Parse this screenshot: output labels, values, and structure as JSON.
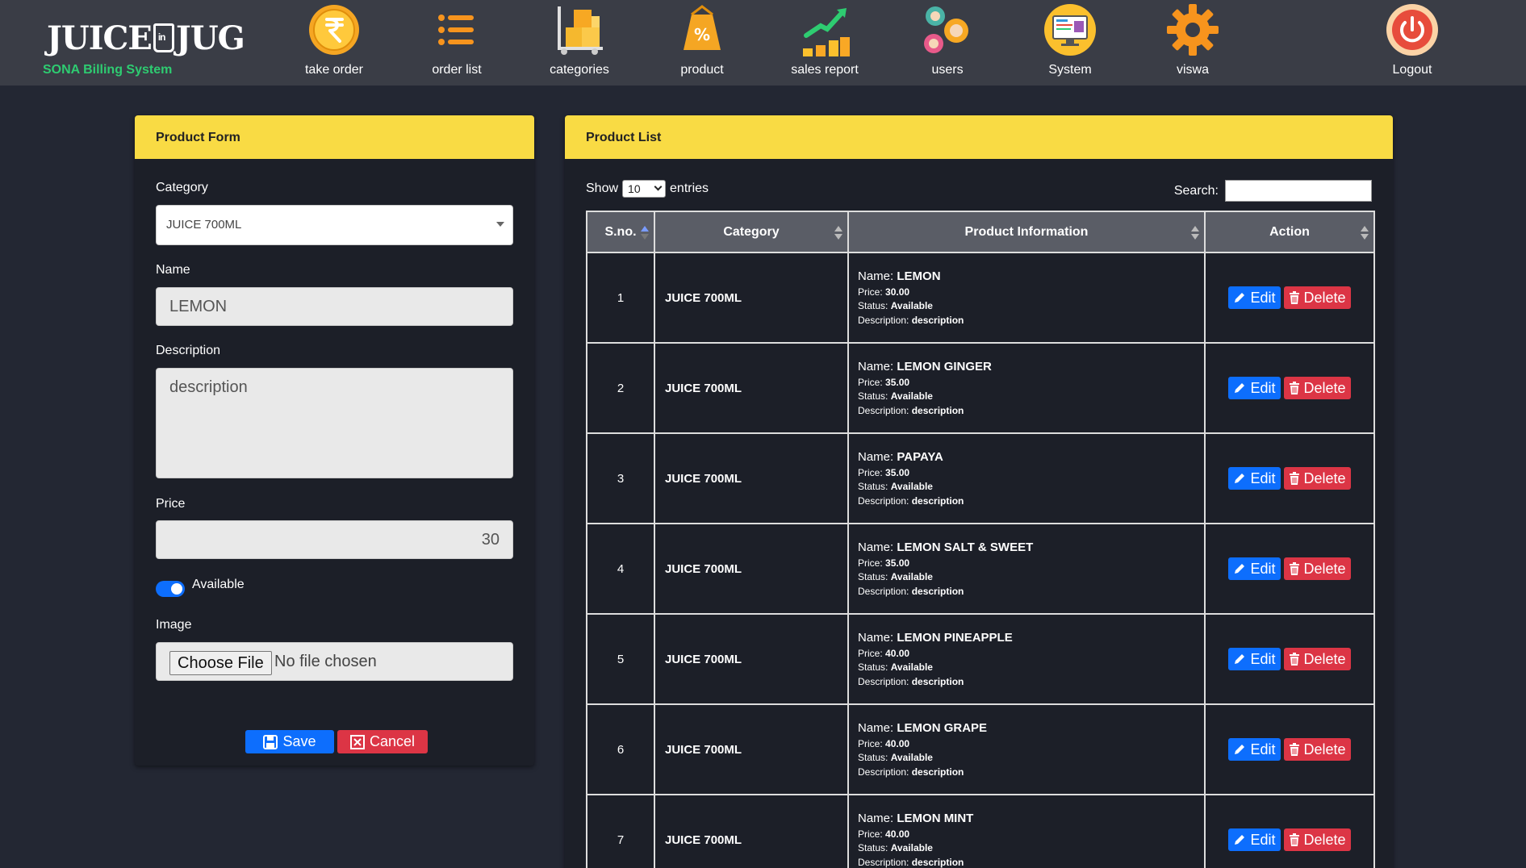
{
  "brand": {
    "logo": "JUICE IN JUG",
    "subtitle": "SONA Billing System"
  },
  "nav": [
    {
      "label": "take order",
      "icon": "rupee-coin-icon"
    },
    {
      "label": "order list",
      "icon": "list-icon"
    },
    {
      "label": "categories",
      "icon": "cart-boxes-icon"
    },
    {
      "label": "product",
      "icon": "price-tag-icon"
    },
    {
      "label": "sales report",
      "icon": "growth-chart-icon"
    },
    {
      "label": "users",
      "icon": "users-gears-icon"
    },
    {
      "label": "System",
      "icon": "monitor-icon"
    },
    {
      "label": "viswa",
      "icon": "gear-icon"
    },
    {
      "label": "Logout",
      "icon": "power-icon"
    }
  ],
  "form": {
    "title": "Product Form",
    "category_label": "Category",
    "category_value": "JUICE 700ML",
    "name_label": "Name",
    "name_value": "LEMON",
    "description_label": "Description",
    "description_value": "description",
    "price_label": "Price",
    "price_value": "30",
    "available_label": "Available",
    "available_on": true,
    "image_label": "Image",
    "file_button": "Choose File",
    "file_text": "No file chosen",
    "save_label": "Save",
    "cancel_label": "Cancel"
  },
  "list": {
    "title": "Product List",
    "show_label": "Show",
    "page_length": "10",
    "entries_label": "entries",
    "search_label": "Search:",
    "columns": [
      "S.no.",
      "Category",
      "Product Information",
      "Action"
    ],
    "info_labels": {
      "name": "Name:",
      "price": "Price:",
      "status": "Status:",
      "description": "Description:"
    },
    "edit_label": "Edit",
    "delete_label": "Delete",
    "rows": [
      {
        "sno": "1",
        "category": "JUICE 700ML",
        "name": "LEMON",
        "price": "30.00",
        "status": "Available",
        "description": "description"
      },
      {
        "sno": "2",
        "category": "JUICE 700ML",
        "name": "LEMON GINGER",
        "price": "35.00",
        "status": "Available",
        "description": "description"
      },
      {
        "sno": "3",
        "category": "JUICE 700ML",
        "name": "PAPAYA",
        "price": "35.00",
        "status": "Available",
        "description": "description"
      },
      {
        "sno": "4",
        "category": "JUICE 700ML",
        "name": "LEMON SALT & SWEET",
        "price": "35.00",
        "status": "Available",
        "description": "description"
      },
      {
        "sno": "5",
        "category": "JUICE 700ML",
        "name": "LEMON PINEAPPLE",
        "price": "40.00",
        "status": "Available",
        "description": "description"
      },
      {
        "sno": "6",
        "category": "JUICE 700ML",
        "name": "LEMON GRAPE",
        "price": "40.00",
        "status": "Available",
        "description": "description"
      },
      {
        "sno": "7",
        "category": "JUICE 700ML",
        "name": "LEMON MINT",
        "price": "40.00",
        "status": "Available",
        "description": "description"
      }
    ]
  },
  "colors": {
    "header_bg": "#3a3d46",
    "page_bg": "#232733",
    "card_head": "#f9db44",
    "primary": "#0d6efd",
    "danger": "#dc3545",
    "brand_green": "#2ecc71"
  }
}
